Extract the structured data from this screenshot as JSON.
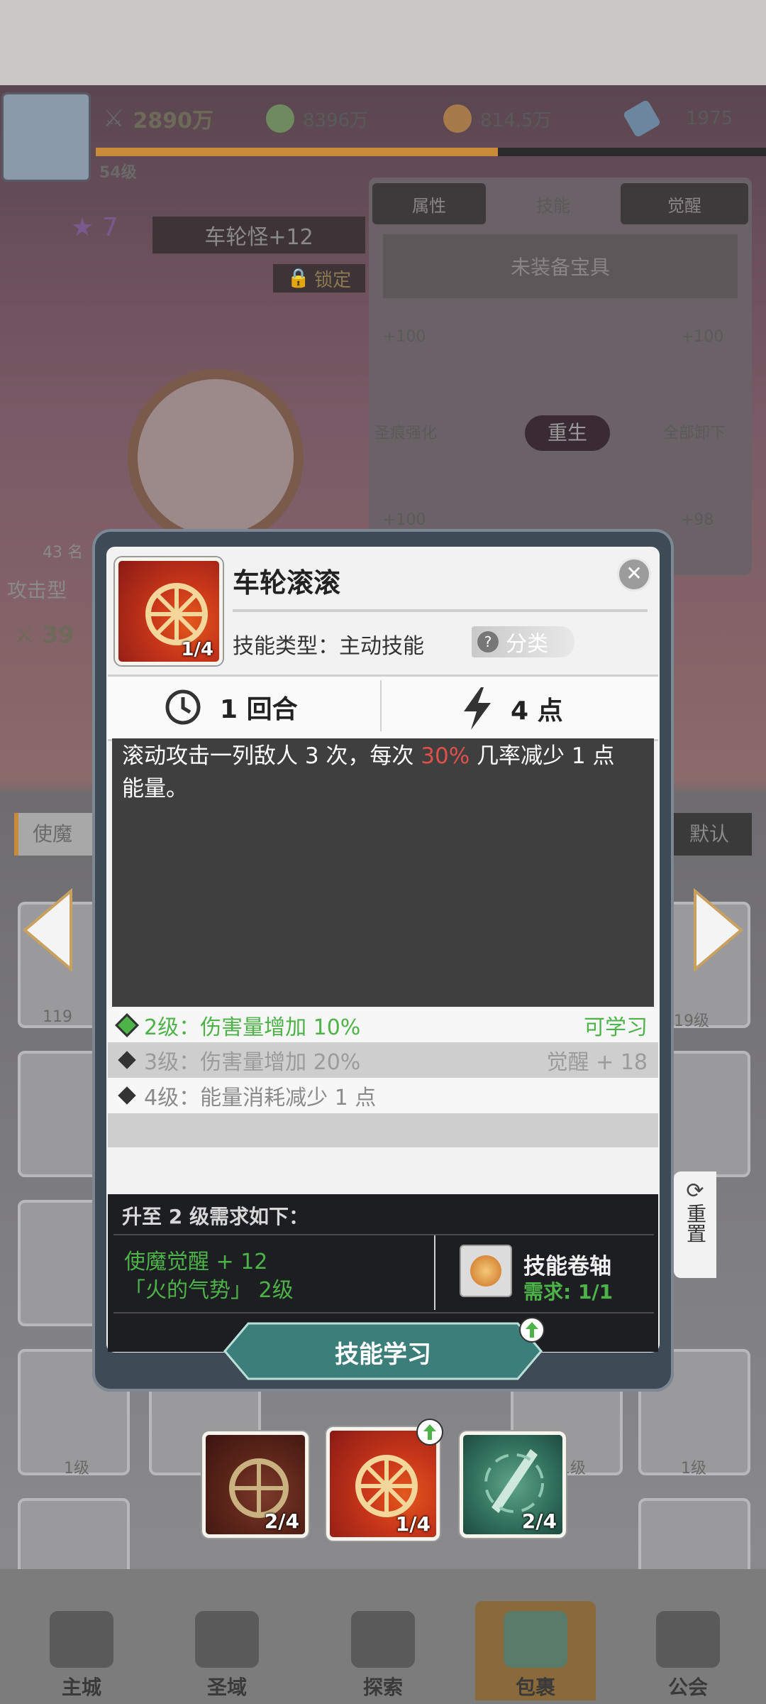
{
  "player": {
    "level": "54级",
    "power": "2890万",
    "green_coin": "8396万",
    "gold_coin": "814.5万",
    "gem": "1975"
  },
  "hero": {
    "stars": "7",
    "name": "车轮怪+12",
    "lock_label": "锁定",
    "team_count": "43 名",
    "type": "攻击型",
    "power": "39"
  },
  "side_panel": {
    "tabs": [
      "属性",
      "技能",
      "觉醒"
    ],
    "equip_placeholder": "未装备宝具",
    "slot_values": [
      "+100",
      "+100",
      "+100",
      "+98"
    ],
    "center_label": "重生",
    "left_btn": "圣痕强化",
    "right_btn": "全部卸下"
  },
  "list_header": {
    "left": "使魔",
    "right": "默认"
  },
  "grid_levels": [
    "119",
    "19级",
    "1级",
    "1级",
    "1级"
  ],
  "nav": [
    "主城",
    "圣域",
    "探索",
    "包裹",
    "公会"
  ],
  "reset_label": "重置",
  "skill_dialog": {
    "title": "车轮滚滚",
    "icon_level": "1/4",
    "type_label": "技能类型：主动技能",
    "category_label": "分类",
    "cooldown": "1 回合",
    "cost": "4 点",
    "desc_pre": "滚动攻击一列敌人 3 次，每次 ",
    "desc_highlight": "30%",
    "desc_post": " 几率减少 1 点能量。",
    "levels": [
      {
        "text": "2级：伤害量增加 10%",
        "status": "可学习"
      },
      {
        "text": "3级：伤害量增加 20%",
        "status": "觉醒 + 18"
      },
      {
        "text": "4级：能量消耗减少 1 点",
        "status": ""
      }
    ],
    "req_title": "升至 2 级需求如下：",
    "req_line1": "使魔觉醒 + 12",
    "req_line2": "「火的气势」 2级",
    "item_name": "技能卷轴",
    "item_req": "需求: 1/1",
    "learn_button": "技能学习",
    "colors": {
      "highlight": "#e0504a",
      "green": "#4db348",
      "dialog_bg": "#3f4a57"
    }
  },
  "skill_tray": [
    {
      "level": "2/4"
    },
    {
      "level": "1/4"
    },
    {
      "level": "2/4"
    }
  ]
}
